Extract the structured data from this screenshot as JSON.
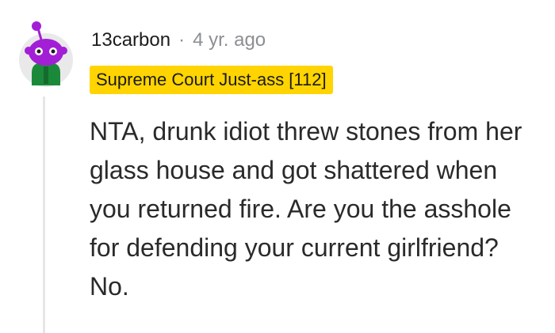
{
  "comment": {
    "username": "13carbon",
    "separator": "·",
    "age": "4 yr. ago",
    "flair": "Supreme Court Just-ass [112]",
    "body": "NTA, drunk idiot threw stones from her glass house and got shattered when you returned fire. Are you the asshole for defending your current girlfriend? No."
  },
  "colors": {
    "flair_background": "#ffd400",
    "avatar_purple": "#a21fd6",
    "avatar_shirt": "#1a8a3a",
    "avatar_background": "#e9e9e9",
    "thread_line": "#e6e6e6"
  },
  "icons": {
    "avatar": "snoo-avatar-icon"
  }
}
